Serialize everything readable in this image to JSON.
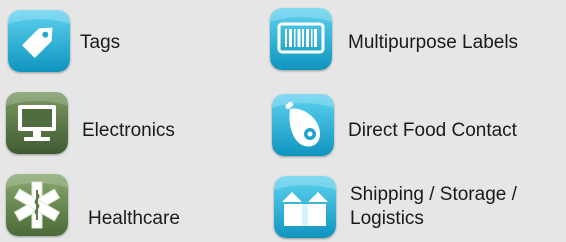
{
  "categories": [
    {
      "label": "Tags",
      "icon": "tag-icon",
      "color": "#1fb1d8"
    },
    {
      "label": "Electronics",
      "icon": "computer-monitor-icon",
      "color": "#4e6b3e"
    },
    {
      "label": "Healthcare",
      "icon": "star-of-life-icon",
      "color": "#5d7d4a"
    },
    {
      "label": "Multipurpose Labels",
      "icon": "barcode-icon",
      "color": "#1fb1d8"
    },
    {
      "label": "Direct Food Contact",
      "icon": "ham-icon",
      "color": "#1fb1d8"
    },
    {
      "label": "Shipping / Storage / ",
      "label2": "Logistics",
      "icon": "open-box-icon",
      "color": "#1fb1d8"
    }
  ]
}
